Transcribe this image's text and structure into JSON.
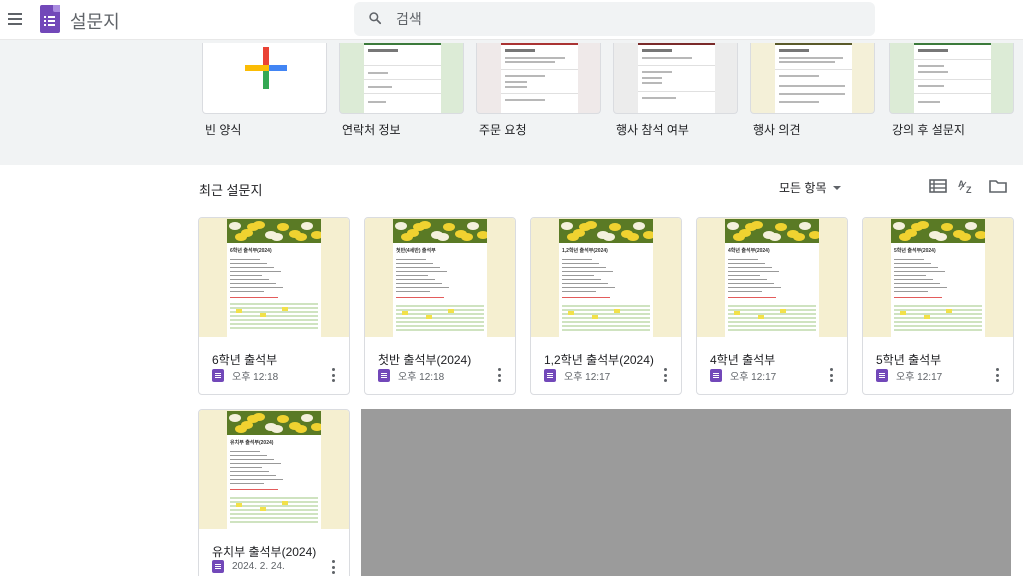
{
  "app": {
    "title": "설문지"
  },
  "search": {
    "placeholder": "검색"
  },
  "templates": [
    {
      "label": "빈 양식",
      "kind": "blank",
      "heading": "",
      "accent": "#ffffff"
    },
    {
      "label": "연락처 정보",
      "kind": "form",
      "heading": "연락처 정보",
      "accent": "#dcebd6"
    },
    {
      "label": "주문 요청",
      "kind": "form",
      "heading": "주문 요청",
      "accent": "#efe9e9"
    },
    {
      "label": "행사 참석 여부",
      "kind": "form",
      "heading": "행사 참석 여부",
      "accent": "#ececec"
    },
    {
      "label": "행사 의견",
      "kind": "form",
      "heading": "행사 의견",
      "accent": "#f4f0d8"
    },
    {
      "label": "강의 후 설문지",
      "kind": "form",
      "heading": "강의 후 설문지",
      "accent": "#dcebd6"
    }
  ],
  "recent": {
    "title": "최근 설문지",
    "owner_filter": "모든 항목",
    "tools": [
      "list-view-icon",
      "sort-az-icon",
      "folder-icon"
    ]
  },
  "docs": [
    {
      "title": "6학년 출석부",
      "thumb_title": "6학년 출석부(2024)",
      "time": "오후 12:18"
    },
    {
      "title": "첫반 출석부(2024)",
      "thumb_title": "첫반(4세반) 출석부",
      "time": "오후 12:18"
    },
    {
      "title": "1,2학년 출석부(2024)",
      "thumb_title": "1,2학년 출석부(2024)",
      "time": "오후 12:17"
    },
    {
      "title": "4학년 출석부",
      "thumb_title": "4학년 출석부(2024)",
      "time": "오후 12:17"
    },
    {
      "title": "5학년 출석부",
      "thumb_title": "5학년 출석부(2024)",
      "time": "오후 12:17"
    },
    {
      "title": "유치부 출석부(2024)",
      "thumb_title": "유치부 출석부(2024)",
      "time": "2024. 2. 24."
    }
  ],
  "colors": {
    "brand": "#7248b9",
    "header_bg": "#ffffff",
    "band_bg": "#f1f3f4",
    "overlay": "#9b9b9b"
  }
}
